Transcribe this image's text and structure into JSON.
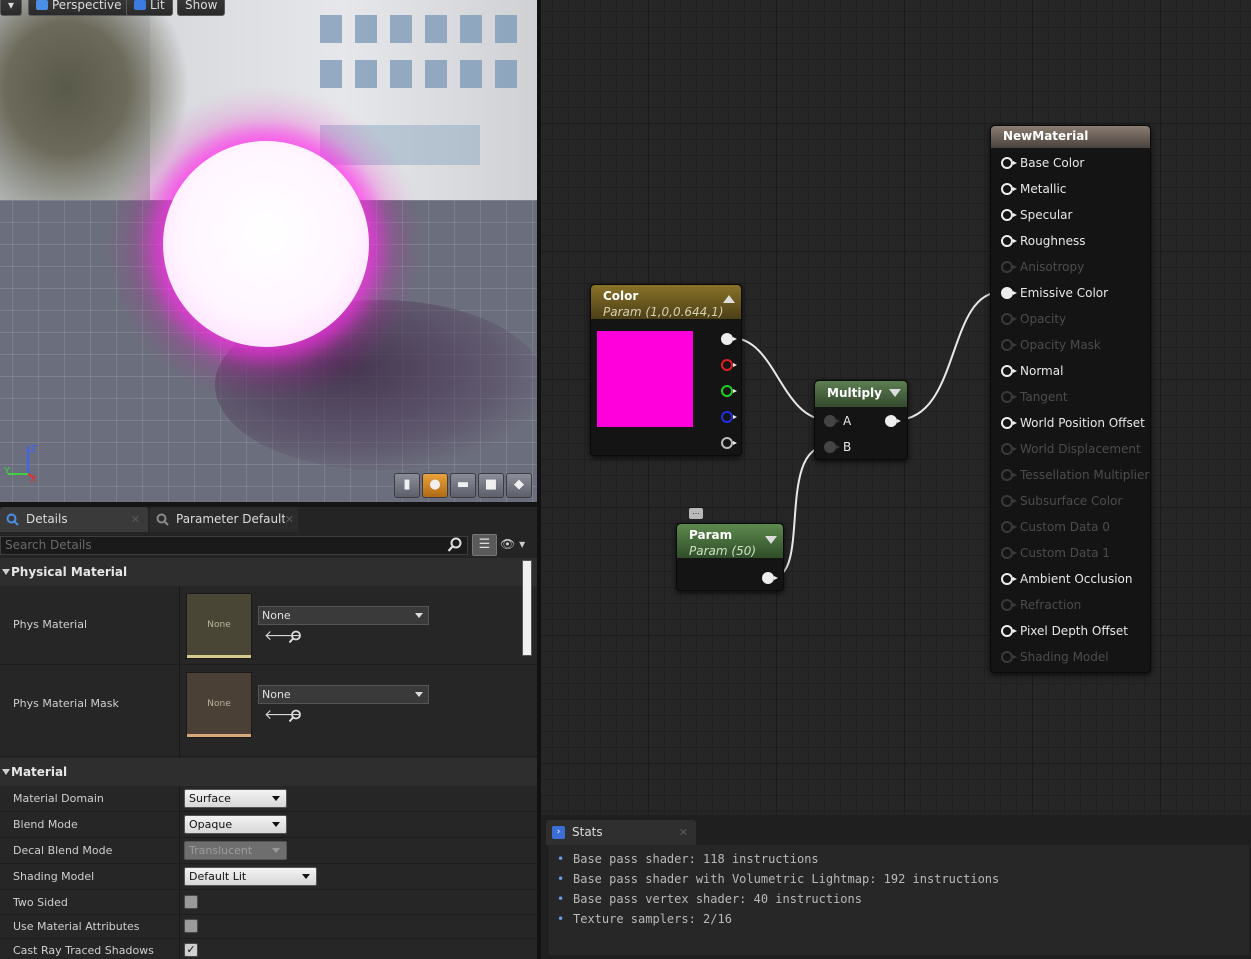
{
  "viewport": {
    "toolbar": {
      "perspective": "Perspective",
      "lit": "Lit",
      "show": "Show"
    },
    "axis": {
      "z": "Z",
      "y": "Y",
      "x": "X"
    },
    "preview_color": "#ff00dc"
  },
  "graph": {
    "color_node": {
      "title": "Color",
      "subtitle": "Param (1,0,0.644,1)",
      "swatch": "#ff00dc"
    },
    "multiply_node": {
      "title": "Multiply",
      "input_a": "A",
      "input_b": "B"
    },
    "param_node": {
      "title": "Param",
      "subtitle": "Param (50)"
    },
    "material_node": {
      "title": "NewMaterial",
      "pins": [
        {
          "label": "Base Color",
          "enabled": true
        },
        {
          "label": "Metallic",
          "enabled": true
        },
        {
          "label": "Specular",
          "enabled": true
        },
        {
          "label": "Roughness",
          "enabled": true
        },
        {
          "label": "Anisotropy",
          "enabled": false
        },
        {
          "label": "Emissive Color",
          "enabled": true,
          "connected": true
        },
        {
          "label": "Opacity",
          "enabled": false
        },
        {
          "label": "Opacity Mask",
          "enabled": false
        },
        {
          "label": "Normal",
          "enabled": true
        },
        {
          "label": "Tangent",
          "enabled": false
        },
        {
          "label": "World Position Offset",
          "enabled": true
        },
        {
          "label": "World Displacement",
          "enabled": false
        },
        {
          "label": "Tessellation Multiplier",
          "enabled": false
        },
        {
          "label": "Subsurface Color",
          "enabled": false
        },
        {
          "label": "Custom Data 0",
          "enabled": false
        },
        {
          "label": "Custom Data 1",
          "enabled": false
        },
        {
          "label": "Ambient Occlusion",
          "enabled": true
        },
        {
          "label": "Refraction",
          "enabled": false
        },
        {
          "label": "Pixel Depth Offset",
          "enabled": true
        },
        {
          "label": "Shading Model",
          "enabled": false
        }
      ]
    }
  },
  "details": {
    "tabs": {
      "details": "Details",
      "parameter_defaults": "Parameter Defaults"
    },
    "search_placeholder": "Search Details",
    "physical_material": {
      "header": "Physical Material",
      "phys_material": {
        "label": "Phys Material",
        "thumb": "None",
        "value": "None"
      },
      "phys_material_mask": {
        "label": "Phys Material Mask",
        "thumb": "None",
        "value": "None"
      }
    },
    "material": {
      "header": "Material",
      "material_domain": {
        "label": "Material Domain",
        "value": "Surface"
      },
      "blend_mode": {
        "label": "Blend Mode",
        "value": "Opaque"
      },
      "decal_blend_mode": {
        "label": "Decal Blend Mode",
        "value": "Translucent"
      },
      "shading_model": {
        "label": "Shading Model",
        "value": "Default Lit"
      },
      "two_sided": {
        "label": "Two Sided",
        "checked": false
      },
      "use_material_attributes": {
        "label": "Use Material Attributes",
        "checked": false
      },
      "cast_ray_traced_shadows": {
        "label": "Cast Ray Traced Shadows",
        "checked": true,
        "mark": "✓"
      }
    }
  },
  "stats": {
    "tab": "Stats",
    "lines": [
      "Base pass shader: 118 instructions",
      "Base pass shader with Volumetric Lightmap: 192 instructions",
      "Base pass vertex shader: 40 instructions",
      "Texture samplers: 2/16"
    ]
  }
}
